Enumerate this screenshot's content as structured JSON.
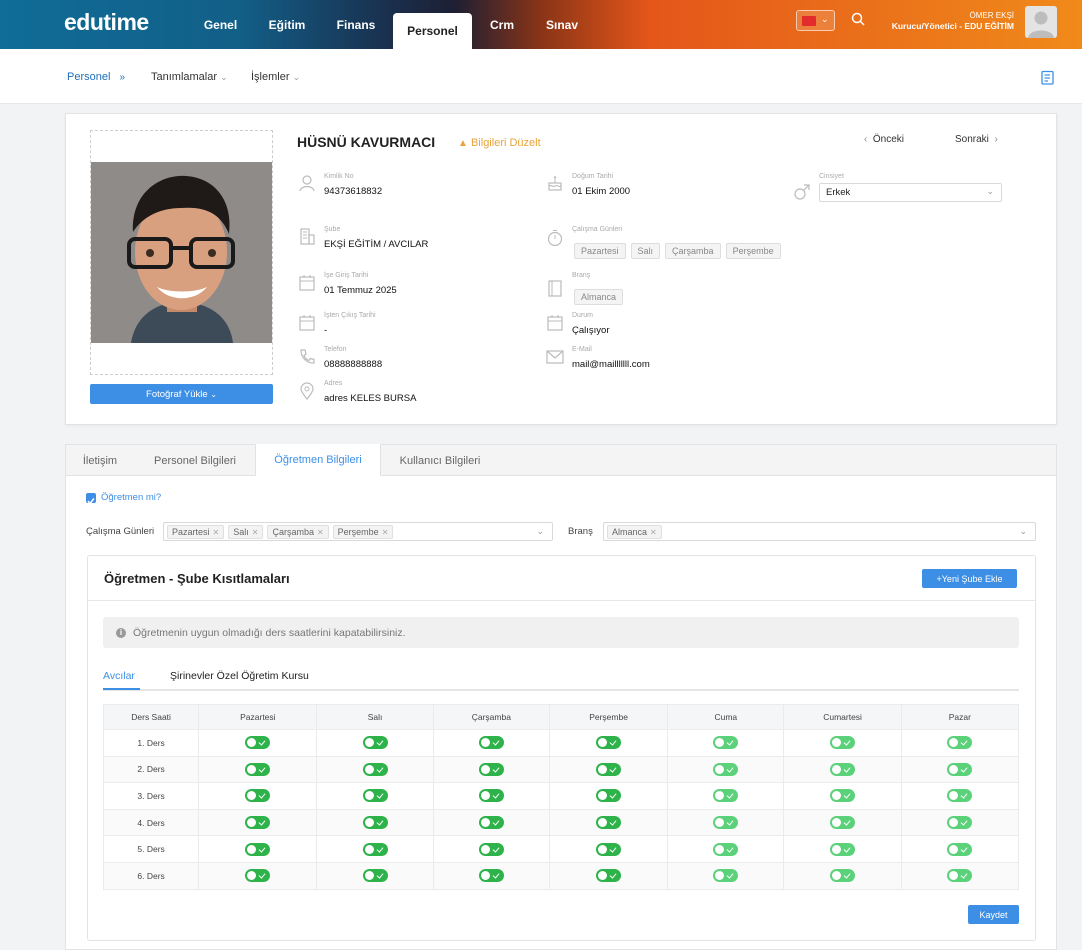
{
  "app": {
    "logo": "edutime"
  },
  "nav": {
    "items": [
      "Genel",
      "Eğitim",
      "Finans",
      "Personel",
      "Crm",
      "Sınav"
    ],
    "active": "Personel"
  },
  "user": {
    "name": "ÖMER EKŞİ",
    "role": "Kurucu/Yönetici - EDU EĞİTİM"
  },
  "breadcrumb": {
    "root": "Personel",
    "menu1": "Tanımlamalar",
    "menu2": "İşlemler"
  },
  "profile": {
    "name": "HÜSNÜ KAVURMACI",
    "edit_label": "Bilgileri Düzelt",
    "prev_label": "Önceki",
    "next_label": "Sonraki",
    "upload_label": "Fotoğraf Yükle",
    "fields": {
      "tc_label": "Kimlik No",
      "tc_value": "94373618832",
      "birth_label": "Doğum Tarihi",
      "birth_value": "01 Ekim 2000",
      "gender_label": "Cinsiyet",
      "gender_value": "Erkek",
      "branch_office_label": "Şube",
      "branch_office_value": "EKŞİ EĞİTİM / AVCILAR",
      "work_days_label": "Çalışma Günleri",
      "work_days": [
        "Pazartesi",
        "Salı",
        "Çarşamba",
        "Perşembe"
      ],
      "start_label": "İşe Giriş Tarihi",
      "start_value": "01 Temmuz 2025",
      "subject_label": "Branş",
      "subject_value": "Almanca",
      "end_label": "İşten Çıkış Tarihi",
      "end_value": "-",
      "status_label": "Durum",
      "status_value": "Çalışıyor",
      "phone_label": "Telefon",
      "phone_value": "08888888888",
      "email_label": "E-Mail",
      "email_value": "mail@mailllllll.com",
      "address_label": "Adres",
      "address_value": "adres KELES BURSA"
    }
  },
  "tabs": {
    "items": [
      "İletişim",
      "Personel Bilgileri",
      "Öğretmen Bilgileri",
      "Kullanıcı Bilgileri"
    ],
    "active": "Öğretmen Bilgileri"
  },
  "teacher": {
    "is_teacher_label": "Öğretmen mi?",
    "is_teacher": true,
    "work_days_label": "Çalışma Günleri",
    "work_days": [
      "Pazartesi",
      "Salı",
      "Çarşamba",
      "Perşembe"
    ],
    "subject_label": "Branş",
    "subjects": [
      "Almanca"
    ]
  },
  "restrictions": {
    "title": "Öğretmen - Şube Kısıtlamaları",
    "add_label": "+Yeni Şube Ekle",
    "info": "Öğretmenin uygun olmadığı ders saatlerini kapatabilirsiniz.",
    "branch_tabs": [
      "Avcılar",
      "Şirinevler Özel Öğretim Kursu"
    ],
    "active_branch": "Avcılar",
    "columns": [
      "Ders Saati",
      "Pazartesi",
      "Salı",
      "Çarşamba",
      "Perşembe",
      "Cuma",
      "Cumartesi",
      "Pazar"
    ],
    "rows": [
      "1. Ders",
      "2. Ders",
      "3. Ders",
      "4. Ders",
      "5. Ders",
      "6. Ders"
    ],
    "working_days_count": 4,
    "save_label": "Kaydet"
  }
}
